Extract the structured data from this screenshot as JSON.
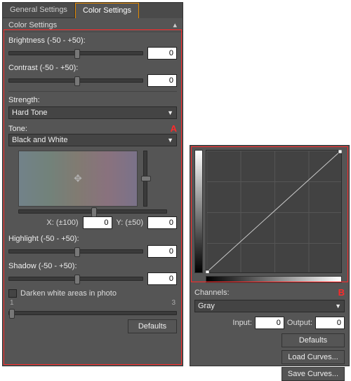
{
  "left": {
    "tabs": {
      "general": "General Settings",
      "color": "Color Settings"
    },
    "section_title": "Color Settings",
    "brightness_label": "Brightness (-50 - +50):",
    "brightness_value": "0",
    "contrast_label": "Contrast (-50 - +50):",
    "contrast_value": "0",
    "strength_label": "Strength:",
    "strength_value": "Hard Tone",
    "tone_label": "Tone:",
    "tone_value": "Black and White",
    "x_label": "X: (±100)",
    "x_value": "0",
    "y_label": "Y: (±50)",
    "y_value": "0",
    "highlight_label": "Highlight (-50 - +50):",
    "highlight_value": "0",
    "shadow_label": "Shadow (-50 - +50):",
    "shadow_value": "0",
    "darken_label": "Darken white areas in photo",
    "scale_1": "1",
    "scale_3": "3",
    "defaults_btn": "Defaults"
  },
  "right": {
    "channels_label": "Channels:",
    "channels_value": "Gray",
    "input_label": "Input:",
    "input_value": "0",
    "output_label": "Output:",
    "output_value": "0",
    "defaults_btn": "Defaults",
    "load_btn": "Load Curves...",
    "save_btn": "Save Curves..."
  }
}
